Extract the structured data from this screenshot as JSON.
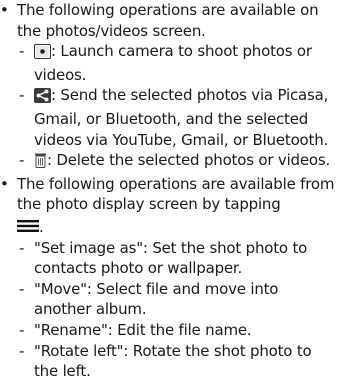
{
  "bullet_symbol": "•",
  "dash_symbol": "-",
  "section1": {
    "intro": "The following operations are available on the photos/videos screen.",
    "items": [
      {
        "icon": "camera-icon",
        "text": ": Launch camera to shoot photos or videos."
      },
      {
        "icon": "share-icon",
        "text": ": Send the selected photos via Picasa, Gmail, or Bluetooth, and the selected videos via YouTube, Gmail, or Bluetooth."
      },
      {
        "icon": "trash-icon",
        "text": ": Delete the selected photos or videos."
      }
    ]
  },
  "section2": {
    "intro": "The following operations are available from the photo display screen by tapping",
    "icon": "menu-icon",
    "trailing": ".",
    "items": [
      {
        "text": "\"Set image as\": Set the shot photo to contacts photo or wallpaper."
      },
      {
        "text": "\"Move\": Select file and move into another album."
      },
      {
        "text": "\"Rename\": Edit the file name."
      },
      {
        "text": "\"Rotate left\": Rotate the shot photo to the left."
      }
    ]
  }
}
